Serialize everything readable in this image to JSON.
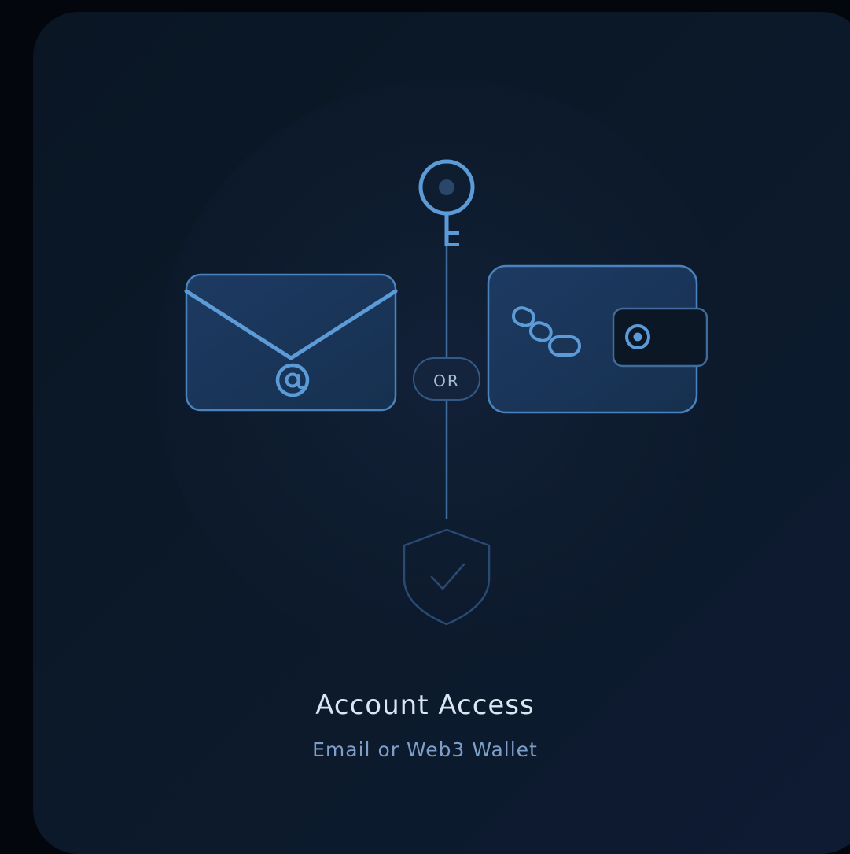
{
  "divider": {
    "label": "OR"
  },
  "card": {
    "title": "Account Access",
    "subtitle": "Email or Web3 Wallet"
  },
  "icons": [
    "key-icon",
    "email-icon",
    "wallet-icon",
    "shield-check-icon"
  ],
  "colors": {
    "page_background": "#03070d",
    "card_background": "#0b1929",
    "accent": "#5b9bd8",
    "title_text": "#dbe6f3",
    "subtitle_text": "#7d9fc9"
  }
}
